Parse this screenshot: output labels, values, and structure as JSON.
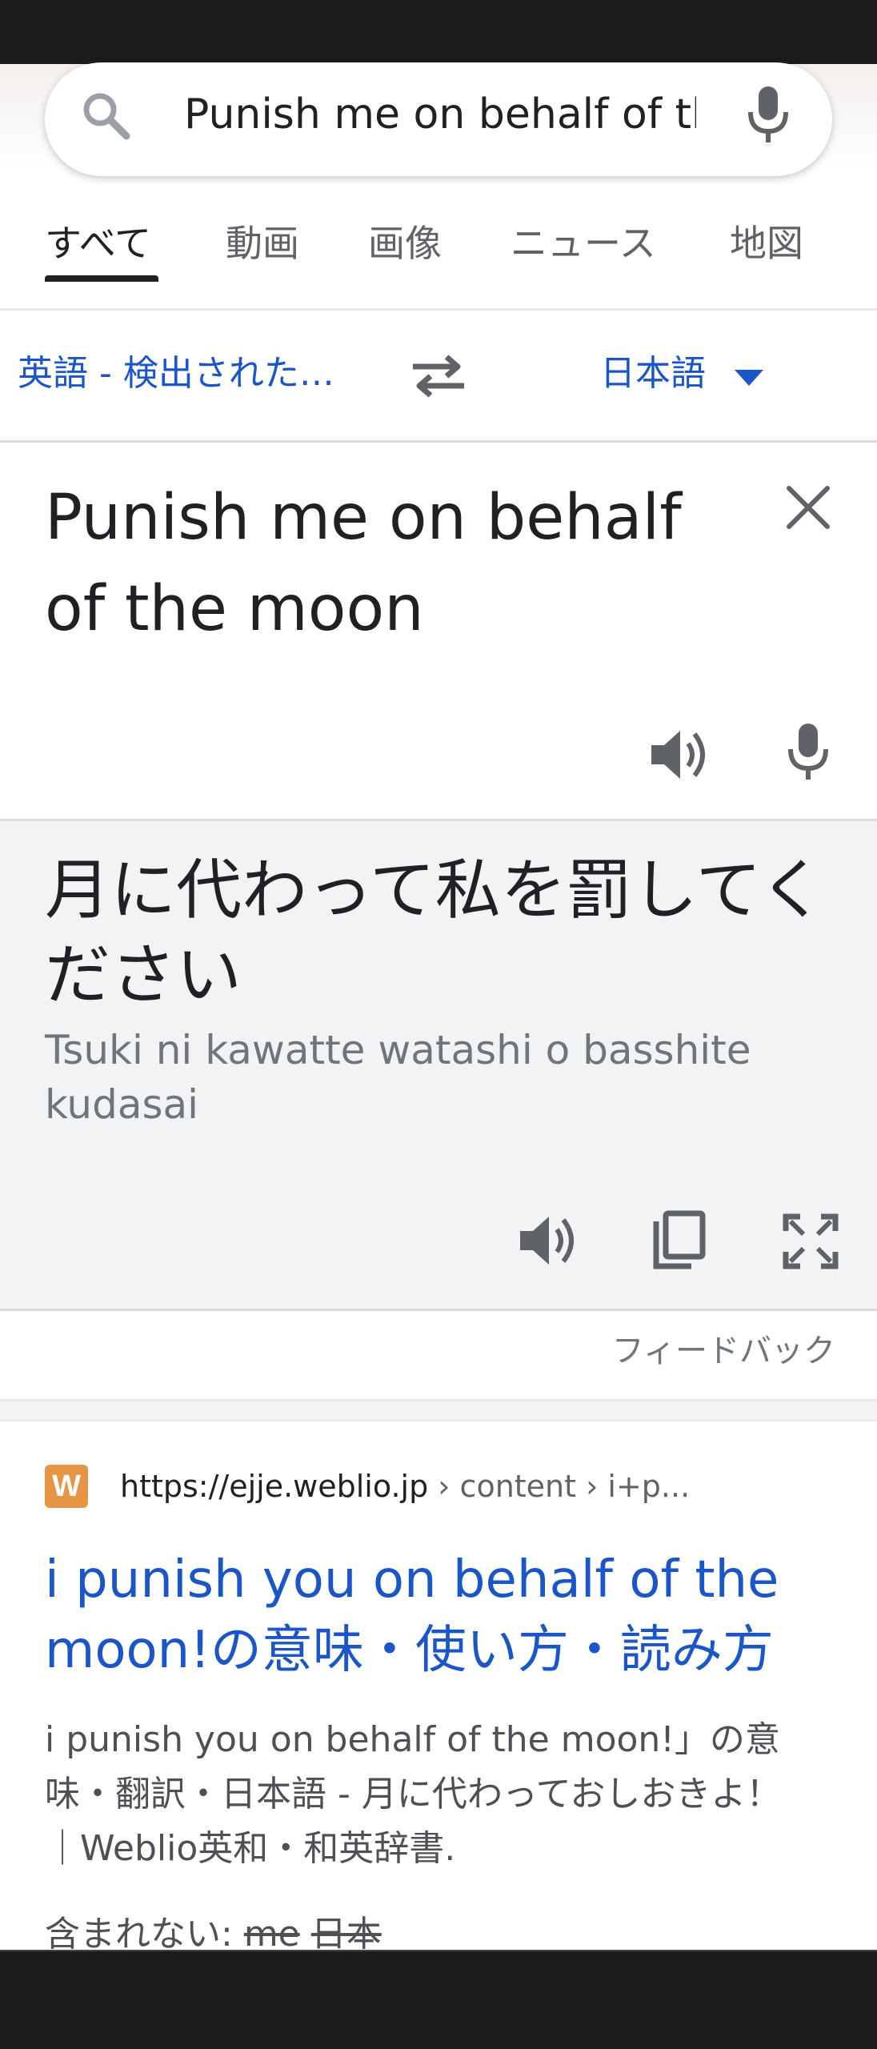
{
  "search": {
    "query": "Punish me on behalf of the"
  },
  "tabs": [
    {
      "label": "すべて"
    },
    {
      "label": "動画"
    },
    {
      "label": "画像"
    },
    {
      "label": "ニュース"
    },
    {
      "label": "地図"
    }
  ],
  "translate": {
    "source_lang": "英語 - 検出された…",
    "target_lang": "日本語",
    "source_text": "Punish me on behalf of the moon",
    "target_text": "月に代わって私を罰してください",
    "romanization": "Tsuki ni kawatte watashi o basshite kudasai",
    "feedback": "フィードバック"
  },
  "result": {
    "favicon_letter": "W",
    "url": "https://ejje.weblio.jp",
    "breadcrumbs": " › content › i+p...",
    "title": "i punish you on behalf of the moon!の意味・使い方・読み方",
    "snippet": "i punish you on behalf of the moon!」の意味・翻訳・日本語 - 月に代わっておしおきよ！｜Weblio英和・和英辞書.",
    "missing_label": "含まれない: ",
    "missing_terms": [
      "me",
      "日本"
    ]
  },
  "colors": {
    "link_blue": "#1a56c8",
    "text_dark": "#202124",
    "text_gray": "#70757a",
    "panel_gray": "#f1f3f4",
    "favicon_orange": "#e59543"
  }
}
